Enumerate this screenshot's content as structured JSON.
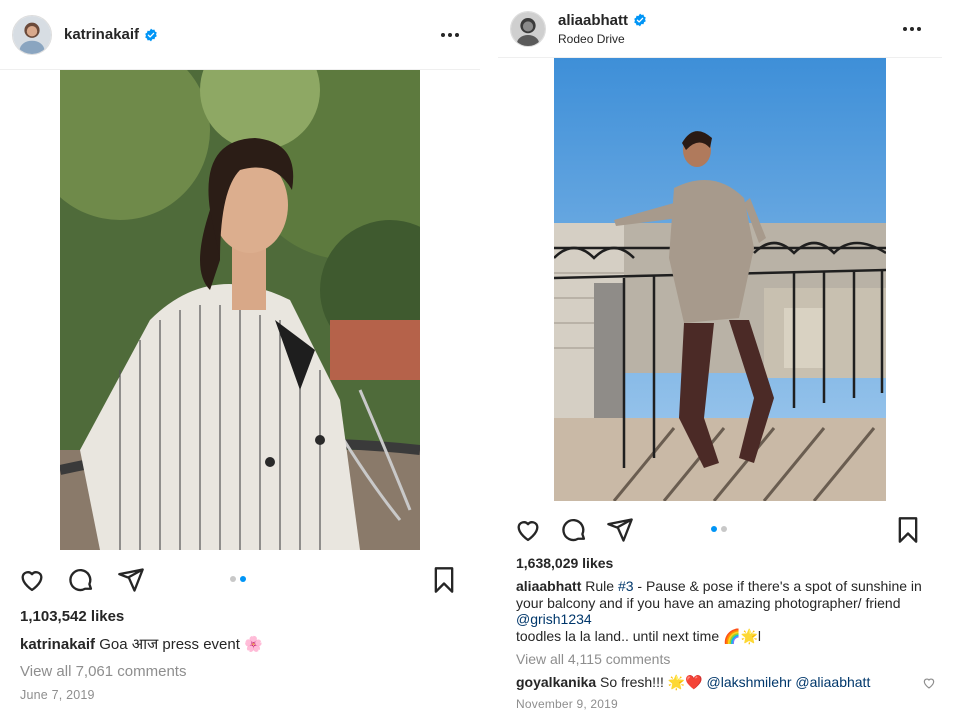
{
  "colors": {
    "text": "#262626",
    "muted": "#8e8e8e",
    "link": "#00376b",
    "verified": "#0095f6",
    "dot_active": "#0095f6",
    "dot_inactive": "#c8c8c8"
  },
  "left_post": {
    "username": "katrinakaif",
    "verified_icon": "verified-badge-icon",
    "more_icon": "more-options-icon",
    "likes": "1,103,542 likes",
    "caption_user": "katrinakaif",
    "caption_text": "Goa आज press event 🌸",
    "view_comments": "View all 7,061 comments",
    "date": "June 7, 2019",
    "carousel_active_index": 1,
    "carousel_count": 2
  },
  "right_post": {
    "username": "aliaabhatt",
    "location": "Rodeo Drive",
    "verified_icon": "verified-badge-icon",
    "more_icon": "more-options-icon",
    "likes": "1,638,029 likes",
    "caption_user": "aliaabhatt",
    "caption_part1": "Rule ",
    "caption_hashtag": "#3",
    "caption_part2": " - Pause & pose if there's a spot of sunshine in your balcony and if you have an amazing photographer/ friend ",
    "caption_mention": "@grish1234",
    "caption_line2": "toodles la la land.. until next time 🌈🌟l",
    "view_comments": "View all 4,115 comments",
    "comment_user": "goyalkanika",
    "comment_text": "So fresh!!! 🌟❤️ ",
    "comment_mentions": "@lakshmilehr @aliaabhatt",
    "date": "November 9, 2019",
    "carousel_active_index": 0,
    "carousel_count": 2
  }
}
